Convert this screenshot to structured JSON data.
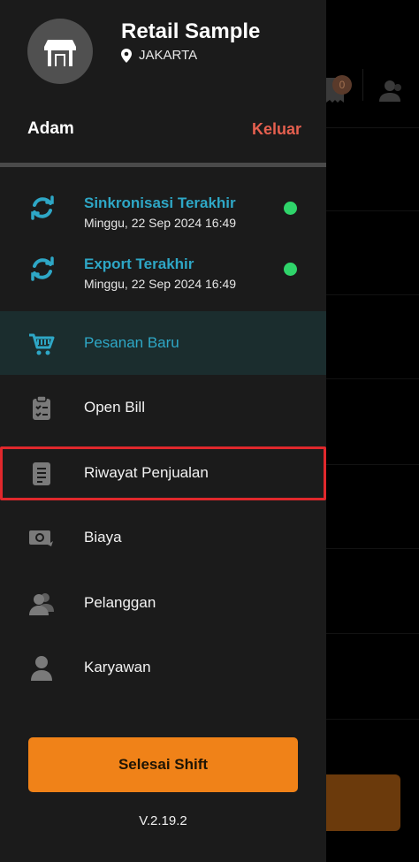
{
  "store": {
    "name": "Retail Sample",
    "location": "JAKARTA"
  },
  "user": {
    "name": "Adam",
    "logout_label": "Keluar"
  },
  "sync": [
    {
      "title": "Sinkronisasi Terakhir",
      "time": "Minggu, 22 Sep 2024 16:49",
      "status_color": "#2fd46a"
    },
    {
      "title": "Export Terakhir",
      "time": "Minggu, 22 Sep 2024 16:49",
      "status_color": "#2fd46a"
    }
  ],
  "menu": [
    {
      "label": "Pesanan Baru",
      "icon": "cart-icon",
      "active": true
    },
    {
      "label": "Open Bill",
      "icon": "clipboard-icon",
      "active": false
    },
    {
      "label": "Riwayat Penjualan",
      "icon": "document-icon",
      "active": false,
      "highlighted": true
    },
    {
      "label": "Biaya",
      "icon": "money-icon",
      "active": false
    },
    {
      "label": "Pelanggan",
      "icon": "users-icon",
      "active": false
    },
    {
      "label": "Karyawan",
      "icon": "person-icon",
      "active": false
    }
  ],
  "background": {
    "cart_badge": "0"
  },
  "footer": {
    "finish_shift_label": "Selesai Shift",
    "version": "V.2.19.2"
  },
  "colors": {
    "accent": "#2ea7c6",
    "logout": "#e5604f",
    "button": "#f08218",
    "highlight": "#e0282c"
  }
}
